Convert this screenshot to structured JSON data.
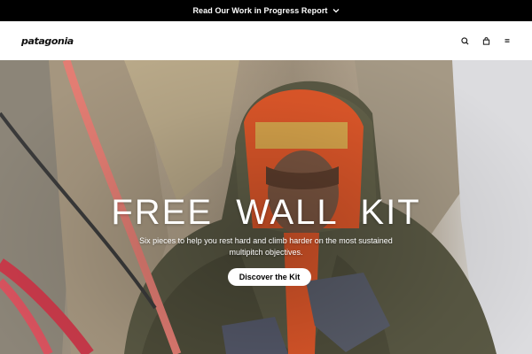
{
  "announcement": {
    "text": "Read Our Work in Progress Report",
    "icon": "chevron-down-icon"
  },
  "header": {
    "logo_text": "patagonia",
    "icons": [
      "search-icon",
      "bag-icon",
      "menu-icon"
    ]
  },
  "hero": {
    "title": "FREE  WALL  KIT",
    "subtitle": "Six pieces to help you rest hard and climb harder on the most sustained multipitch objectives.",
    "cta_label": "Discover the Kit"
  },
  "colors": {
    "announcement_bg": "#000000",
    "header_bg": "#ffffff",
    "cta_bg": "#ffffff",
    "jacket": "#5c5a45",
    "hood_orange": "#e0582a",
    "rope": "#e57a70"
  }
}
